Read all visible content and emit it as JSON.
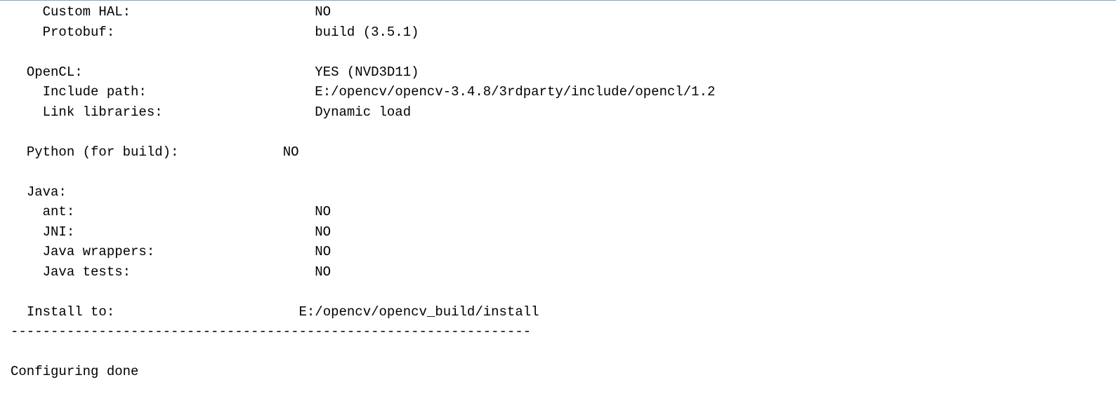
{
  "lines": [
    {
      "indent": "    ",
      "label": "Custom HAL:",
      "pad": 23,
      "value": "NO"
    },
    {
      "indent": "    ",
      "label": "Protobuf:",
      "pad": 25,
      "value": "build (3.5.1)"
    },
    {
      "blank": true
    },
    {
      "indent": "  ",
      "label": "OpenCL:",
      "pad": 29,
      "value": "YES (NVD3D11)"
    },
    {
      "indent": "    ",
      "label": "Include path:",
      "pad": 21,
      "value": "E:/opencv/opencv-3.4.8/3rdparty/include/opencl/1.2"
    },
    {
      "indent": "    ",
      "label": "Link libraries:",
      "pad": 19,
      "value": "Dynamic load"
    },
    {
      "blank": true
    },
    {
      "indent": "  ",
      "label": "Python (for build):",
      "pad": 13,
      "value": "NO"
    },
    {
      "blank": true
    },
    {
      "indent": "  ",
      "label": "Java:",
      "pad": 0,
      "value": ""
    },
    {
      "indent": "    ",
      "label": "ant:",
      "pad": 30,
      "value": "NO"
    },
    {
      "indent": "    ",
      "label": "JNI:",
      "pad": 30,
      "value": "NO"
    },
    {
      "indent": "    ",
      "label": "Java wrappers:",
      "pad": 20,
      "value": "NO"
    },
    {
      "indent": "    ",
      "label": "Java tests:",
      "pad": 23,
      "value": "NO"
    },
    {
      "blank": true
    },
    {
      "indent": "  ",
      "label": "Install to:",
      "pad": 23,
      "value": "E:/opencv/opencv_build/install"
    }
  ],
  "separator": "-----------------------------------------------------------------",
  "footer": "Configuring done"
}
